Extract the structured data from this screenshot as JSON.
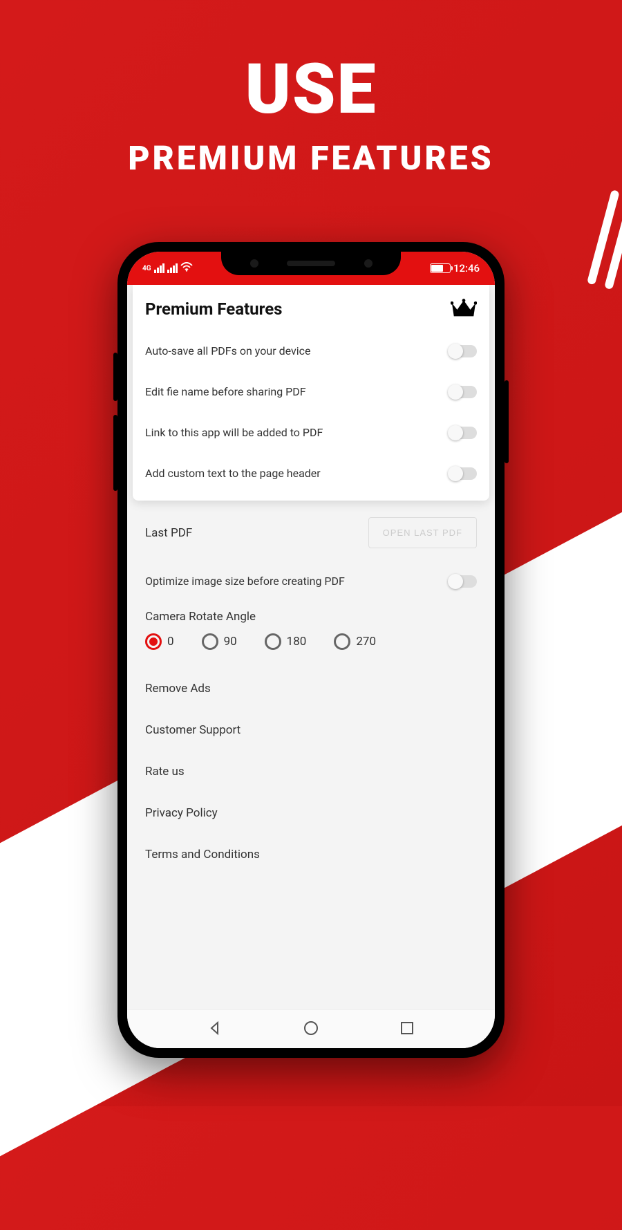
{
  "promo": {
    "title": "USE",
    "subtitle": "PREMIUM FEATURES"
  },
  "status": {
    "time": "12:46"
  },
  "card": {
    "title": "Premium Features",
    "toggles": [
      "Auto-save all PDFs on your device",
      "Edit fie name before sharing PDF",
      "Link to this app will be added to PDF",
      "Add custom text to the page header"
    ]
  },
  "last_pdf": {
    "label": "Last PDF",
    "button": "OPEN LAST PDF"
  },
  "optimize_label": "Optimize image size before creating PDF",
  "angle": {
    "label": "Camera Rotate Angle",
    "options": [
      "0",
      "90",
      "180",
      "270"
    ],
    "selected": "0"
  },
  "menu": [
    "Remove Ads",
    "Customer Support",
    "Rate us",
    "Privacy Policy",
    "Terms and Conditions"
  ]
}
